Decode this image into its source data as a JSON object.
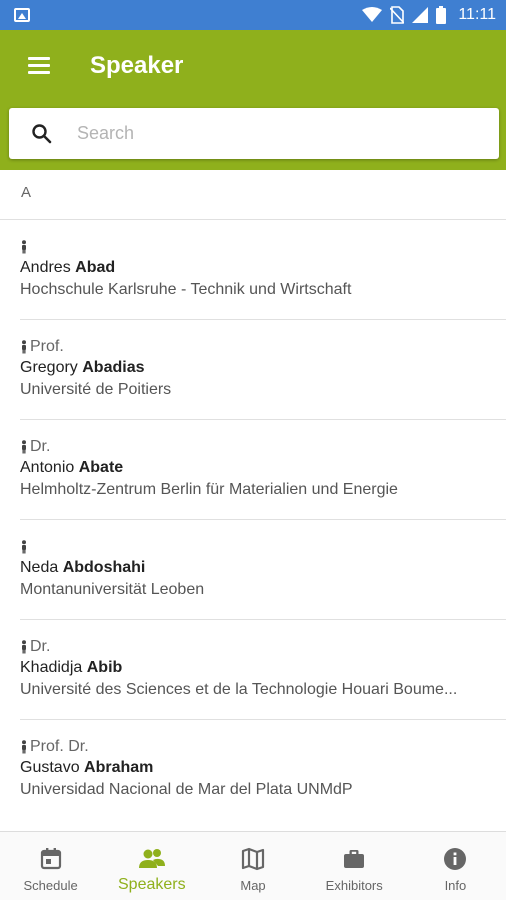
{
  "status_bar": {
    "time": "11:11"
  },
  "app_bar": {
    "title": "Speaker"
  },
  "search": {
    "placeholder": "Search",
    "value": ""
  },
  "list": {
    "section": "A",
    "items": [
      {
        "title": "",
        "first_name": "Andres",
        "last_name": "Abad",
        "organization": "Hochschule Karlsruhe - Technik und Wirtschaft"
      },
      {
        "title": "Prof.",
        "first_name": "Gregory",
        "last_name": "Abadias",
        "organization": "Université de Poitiers"
      },
      {
        "title": "Dr.",
        "first_name": "Antonio",
        "last_name": "Abate",
        "organization": "Helmholtz-Zentrum Berlin für Materialien und Energie"
      },
      {
        "title": "",
        "first_name": "Neda",
        "last_name": "Abdoshahi",
        "organization": "Montanuniversität Leoben"
      },
      {
        "title": "Dr.",
        "first_name": "Khadidja",
        "last_name": "Abib",
        "organization": "Université des Sciences et de la Technologie Houari Boume..."
      },
      {
        "title": "Prof. Dr.",
        "first_name": "Gustavo",
        "last_name": "Abraham",
        "organization": "Universidad Nacional de Mar del Plata UNMdP"
      }
    ]
  },
  "bottom_nav": {
    "items": [
      {
        "label": "Schedule",
        "icon": "calendar-icon"
      },
      {
        "label": "Speakers",
        "icon": "speakers-icon",
        "active": true
      },
      {
        "label": "Map",
        "icon": "map-icon"
      },
      {
        "label": "Exhibitors",
        "icon": "briefcase-icon"
      },
      {
        "label": "Info",
        "icon": "info-icon"
      }
    ]
  },
  "colors": {
    "status_bar": "#3f7fd1",
    "app_bar": "#8fb01c",
    "active_nav": "#8fb01c"
  }
}
